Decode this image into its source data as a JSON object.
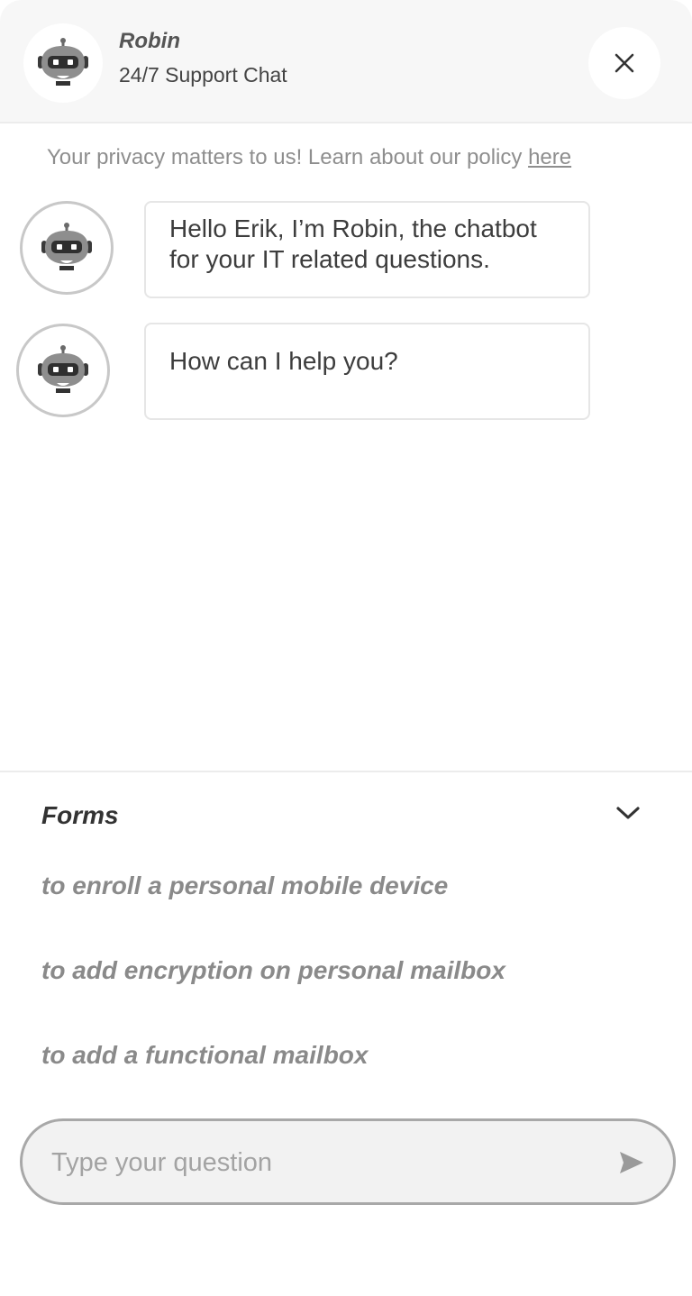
{
  "header": {
    "name": "Robin",
    "subtitle": "24/7 Support Chat",
    "avatar_icon": "robot-icon",
    "close_icon": "close-icon"
  },
  "privacy": {
    "text": "Your privacy matters to us! Learn about our policy ",
    "link_label": "here"
  },
  "messages": [
    {
      "sender": "bot",
      "text": "Hello Erik, I’m Robin, the chatbot for your IT related questions."
    },
    {
      "sender": "bot",
      "text": "How can I help you?"
    }
  ],
  "forms": {
    "title": "Forms",
    "toggle_icon": "chevron-down-icon",
    "items": [
      {
        "label": "to enroll a personal mobile device"
      },
      {
        "label": "to add encryption on personal mailbox"
      },
      {
        "label": "to add a functional mailbox"
      }
    ]
  },
  "input": {
    "placeholder": "Type your question",
    "value": "",
    "send_icon": "send-icon"
  },
  "colors": {
    "header_bg": "#f7f7f7",
    "text_primary": "#3d3d3d",
    "text_muted": "#8a8a8a",
    "input_bg": "#f2f2f2",
    "input_border": "#a8a8a8"
  }
}
